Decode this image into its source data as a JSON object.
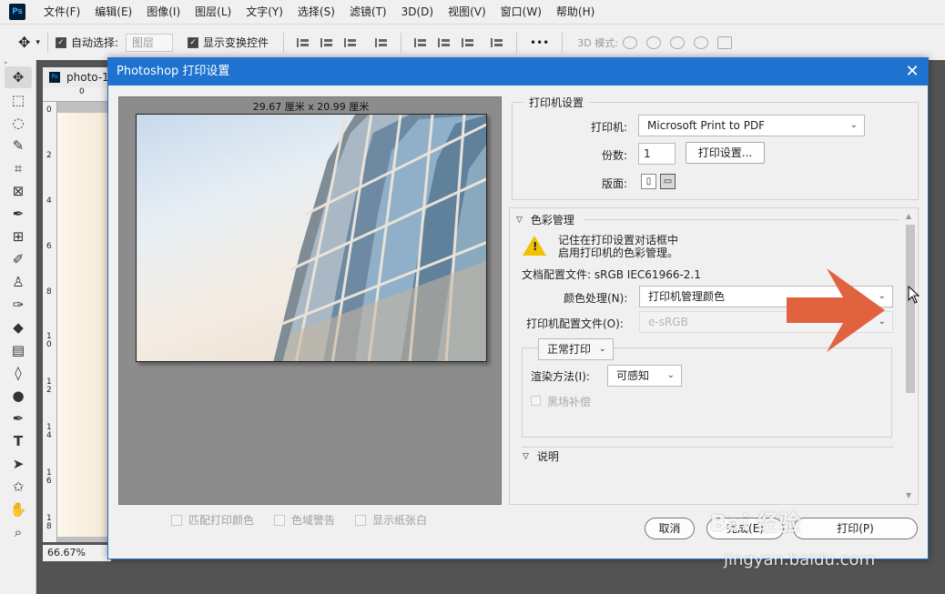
{
  "app": {
    "logo": "Ps"
  },
  "menu": [
    "文件(F)",
    "编辑(E)",
    "图像(I)",
    "图层(L)",
    "文字(Y)",
    "选择(S)",
    "滤镜(T)",
    "3D(D)",
    "视图(V)",
    "窗口(W)",
    "帮助(H)"
  ],
  "options": {
    "auto_select_label": "自动选择:",
    "auto_select_value": "图层",
    "show_transform_label": "显示变换控件",
    "mode_3d_label": "3D 模式:",
    "more": "•••"
  },
  "document": {
    "tab_label": "photo-1",
    "ruler_h_zero": "0",
    "ruler_v_labels": [
      "0",
      "2",
      "4",
      "6",
      "8",
      "1\n0",
      "1\n2",
      "1\n4",
      "1\n6",
      "1\n8"
    ],
    "zoom": "66.67%"
  },
  "dialog": {
    "title": "Photoshop 打印设置",
    "close": "✕",
    "preview_dims": "29.67 厘米 x 20.99 厘米",
    "bottom_checks": [
      "匹配打印颜色",
      "色域警告",
      "显示纸张白"
    ],
    "printer_group_title": "打印机设置",
    "printer_label": "打印机:",
    "printer_value": "Microsoft Print to PDF",
    "copies_label": "份数:",
    "copies_value": "1",
    "print_settings_button": "打印设置...",
    "layout_label": "版面:",
    "color_section_title": "色彩管理",
    "warning_line1": "记住在打印设置对话框中",
    "warning_line2": "启用打印机的色彩管理。",
    "doc_profile": "文档配置文件: sRGB IEC61966-2.1",
    "color_handling_label": "颜色处理(N):",
    "color_handling_value": "打印机管理颜色",
    "printer_profile_label": "打印机配置文件(O):",
    "printer_profile_value": "e-sRGB",
    "normal_print_value": "正常打印",
    "render_intent_label": "渲染方法(I):",
    "render_intent_value": "可感知",
    "black_point_label": "黑场补偿",
    "description_title": "说明",
    "cancel_button": "取消",
    "done_button": "完成(E)",
    "print_button": "打印(P)"
  },
  "watermark": {
    "line1": "Bai 经验",
    "line2": "jingyan.baidu.com"
  },
  "colors": {
    "accent": "#1f73d0",
    "arrow": "#e0623f"
  }
}
